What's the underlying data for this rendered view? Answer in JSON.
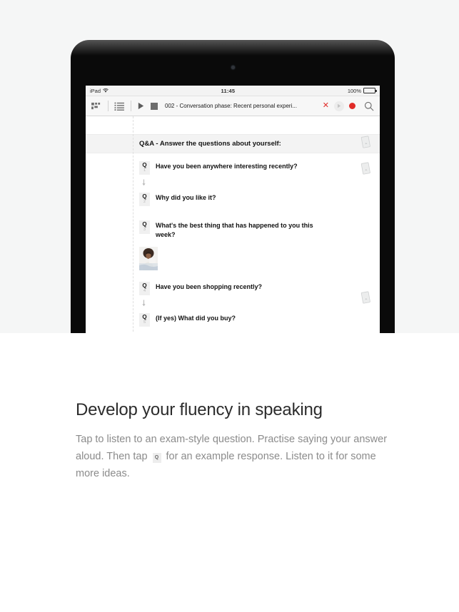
{
  "colors": {
    "page_background": "#ffffff",
    "hero_background": "#f5f6f6",
    "device_body": "#0a0a0a",
    "accent_red": "#e02b28",
    "heading_text": "#2c2c2c",
    "body_text": "#8b8b8b",
    "badge_background": "#f0f0f0"
  },
  "device": {
    "name": "ipad-tablet"
  },
  "status_bar": {
    "device_label": "iPad",
    "wifi_icon": "wifi-icon",
    "time": "11:45",
    "battery_percent": "100%",
    "battery_icon": "battery-full-icon"
  },
  "toolbar": {
    "grid_view_icon": "grid-view-icon",
    "list_view_icon": "list-view-icon",
    "play_icon": "play-icon",
    "stop_icon": "stop-icon",
    "document_title": "002 - Conversation phase: Recent personal experi...",
    "cancel_icon": "close-x-icon",
    "playback_icon": "play-circle-icon",
    "record_icon": "record-dot-icon",
    "search_icon": "search-icon"
  },
  "content": {
    "section_header": "Q&A - Answer the questions about yourself:",
    "badge_letter": "Q",
    "arrow_icon": "arrow-down-icon",
    "card_icon": "page-card-icon",
    "photo_alt": "person-photo",
    "items": [
      {
        "type": "question",
        "number": "1",
        "text": "Have you been anywhere interesting recently?"
      },
      {
        "type": "arrow"
      },
      {
        "type": "question",
        "number": "2",
        "text": "Why did you like it?"
      },
      {
        "type": "question",
        "number": "3",
        "text": "What's the best thing that has happened to you this week?"
      },
      {
        "type": "photo"
      },
      {
        "type": "question",
        "number": "4",
        "text": "Have you been shopping recently?"
      },
      {
        "type": "arrow"
      },
      {
        "type": "question",
        "number": "5",
        "text": "(If yes) What did you buy?"
      }
    ]
  },
  "caption": {
    "heading": "Develop your fluency in speaking",
    "body_part1": "Tap to listen to an exam-style question. Practise saying your answer aloud. Then tap",
    "inline_badge": "Q",
    "body_part2": "for an example response. Listen to it for some more ideas."
  }
}
